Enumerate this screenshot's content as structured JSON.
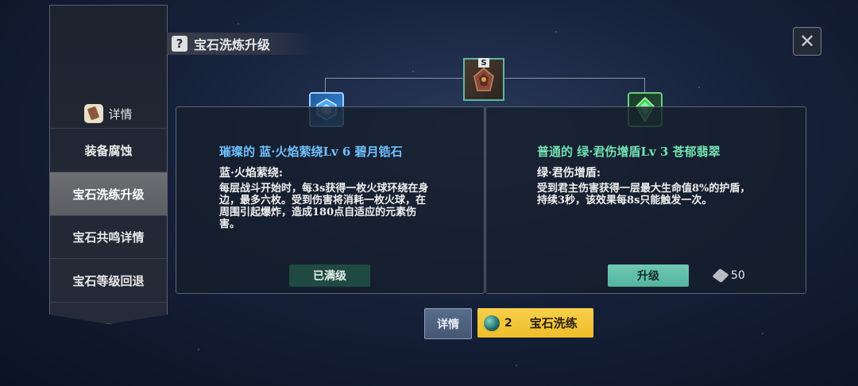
{
  "title": "宝石洗炼升级",
  "sidebar": {
    "header_label": "详情",
    "items": [
      {
        "label": "装备腐蚀"
      },
      {
        "label": "宝石洗练升级"
      },
      {
        "label": "宝石共鸣详情"
      },
      {
        "label": "宝石等级回退"
      }
    ]
  },
  "top_gem": {
    "badge": "S",
    "icon": "dragon-gem-icon"
  },
  "left_panel": {
    "gem_name": "璀璨的 蓝·火焰萦绕Lv 6 碧月锆石",
    "effect_name": "蓝·火焰萦绕:",
    "description": "每层战斗开始时，每3s获得一枚火球环绕在身边，最多六枚。受到伤害将消耗一枚火球，在周围引起爆炸，造成180点自适应的元素伤害。",
    "button_label": "已满级",
    "icon": "blue-gem-icon",
    "name_color": "#6fc0ff"
  },
  "right_panel": {
    "gem_name": "普通的 绿·君伤增盾Lv 3 苍郁翡翠",
    "effect_name": "绿·君伤增盾:",
    "description": "受到君主伤害获得一层最大生命值8%的护盾，持续3秒，该效果每8s只能触发一次。",
    "button_label": "升级",
    "cost_value": "50",
    "icon": "green-gem-icon",
    "name_color": "#72e0b2"
  },
  "bottom": {
    "detail_label": "详情",
    "refine_count": "2",
    "refine_label": "宝石洗练"
  }
}
